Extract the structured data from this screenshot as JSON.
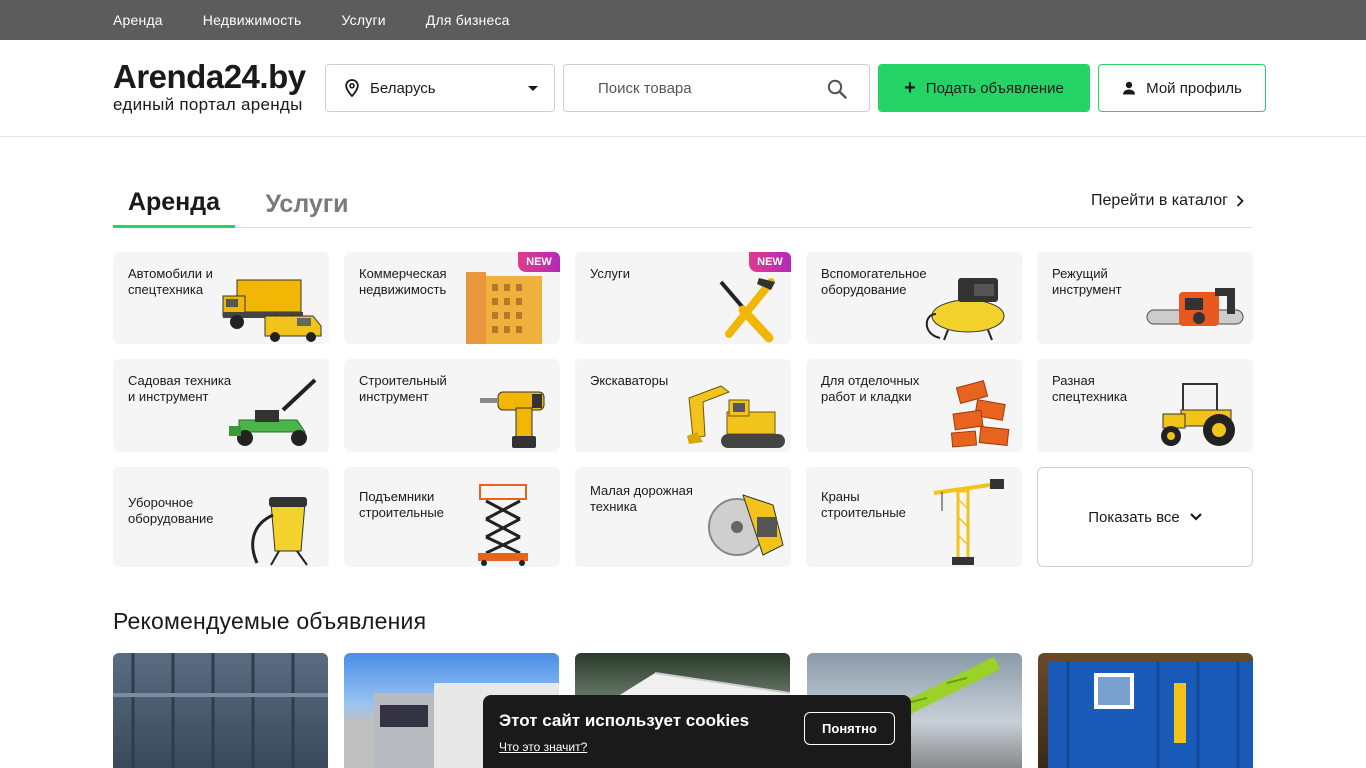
{
  "topnav": [
    "Аренда",
    "Недвижимость",
    "Услуги",
    "Для бизнеса"
  ],
  "logo": {
    "name": "Arenda24.by",
    "tagline": "единый портал аренды"
  },
  "region": {
    "value": "Беларусь",
    "icon": "location-pin-icon"
  },
  "search": {
    "placeholder": "Поиск товара",
    "icon": "search-icon"
  },
  "actions": {
    "post_label": "Подать объявление",
    "profile_label": "Мой профиль"
  },
  "tabs": {
    "active": "Аренда",
    "inactive": "Услуги",
    "catalog_link": "Перейти в каталог"
  },
  "categories": [
    {
      "label": "Автомобили и спецтехника",
      "badge": ""
    },
    {
      "label": "Коммерческая недвижимость",
      "badge": "NEW"
    },
    {
      "label": "Услуги",
      "badge": "NEW"
    },
    {
      "label": "Вспомогательное оборудование",
      "badge": ""
    },
    {
      "label": "Режущий инструмент",
      "badge": ""
    },
    {
      "label": "Садовая техника и инструмент",
      "badge": ""
    },
    {
      "label": "Строительный инструмент",
      "badge": ""
    },
    {
      "label": "Экскаваторы",
      "badge": ""
    },
    {
      "label": "Для отделочных работ и кладки",
      "badge": ""
    },
    {
      "label": "Разная спецтехника",
      "badge": ""
    },
    {
      "label": "Уборочное оборудование",
      "badge": ""
    },
    {
      "label": "Подъемники строительные",
      "badge": ""
    },
    {
      "label": "Малая дорожная техника",
      "badge": ""
    },
    {
      "label": "Краны строительные",
      "badge": ""
    }
  ],
  "show_all_label": "Показать все",
  "recommended_title": "Рекомендуемые объявления",
  "cookie": {
    "text": "Этот сайт использует cookies",
    "link": "Что это значит?",
    "button": "Понятно"
  },
  "colors": {
    "accent": "#25d366",
    "topbar": "#5c5c5c",
    "card_bg": "#f5f5f5",
    "cookie_bg": "#1a1a1a"
  }
}
